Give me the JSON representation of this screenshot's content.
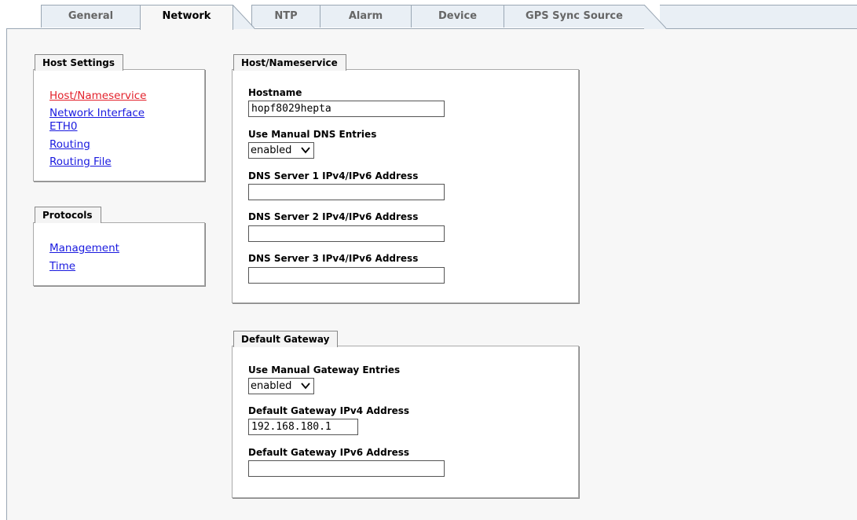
{
  "tabs": [
    "General",
    "Network",
    "NTP",
    "Alarm",
    "Device",
    "GPS Sync Source"
  ],
  "active_tab": "Network",
  "sidebar": {
    "host_settings": {
      "title": "Host Settings",
      "links": [
        "Host/Nameservice",
        "Network Interface",
        "ETH0",
        "Routing",
        "Routing File"
      ]
    },
    "protocols": {
      "title": "Protocols",
      "links": [
        "Management",
        "Time"
      ]
    }
  },
  "host_nameservice": {
    "title": "Host/Nameservice",
    "hostname_label": "Hostname",
    "hostname_value": "hopf8029hepta",
    "manual_dns_label": "Use Manual DNS Entries",
    "manual_dns_value": "enabled",
    "dns1_label": "DNS Server 1 IPv4/IPv6 Address",
    "dns1_value": "",
    "dns2_label": "DNS Server 2 IPv4/IPv6 Address",
    "dns2_value": "",
    "dns3_label": "DNS Server 3 IPv4/IPv6 Address",
    "dns3_value": ""
  },
  "default_gateway": {
    "title": "Default Gateway",
    "manual_gw_label": "Use Manual Gateway Entries",
    "manual_gw_value": "enabled",
    "ipv4_label": "Default Gateway IPv4 Address",
    "ipv4_value": "192.168.180.1",
    "ipv6_label": "Default Gateway IPv6 Address",
    "ipv6_value": ""
  },
  "colors": {
    "link": "#1a1adf",
    "current_link": "#e3222c",
    "tab_bg": "#e9eff5",
    "panel_bg": "#f7f7f7"
  }
}
